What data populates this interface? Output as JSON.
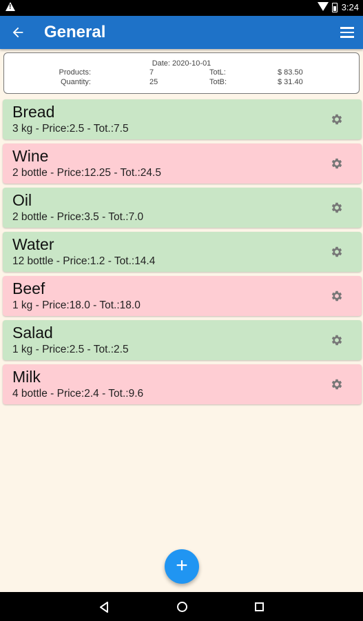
{
  "status_bar": {
    "time": "3:24",
    "icons": [
      "warning-icon",
      "wifi-icon",
      "battery-icon"
    ]
  },
  "app_bar": {
    "title": "General",
    "back_icon": "arrow-left-icon",
    "menu_icon": "hamburger-menu-icon",
    "color": "#1e72c8"
  },
  "summary": {
    "date": "Date: 2020-10-01",
    "products_label": "Products:",
    "products_value": "7",
    "quantity_label": "Quantity:",
    "quantity_value": "25",
    "totl_label": "TotL:",
    "totl_value": "$ 83.50",
    "totb_label": "TotB:",
    "totb_value": "$ 31.40"
  },
  "items": [
    {
      "name": "Bread",
      "detail": "3 kg - Price:2.5 - Tot.:7.5",
      "status": "green"
    },
    {
      "name": "Wine",
      "detail": "2 bottle - Price:12.25 - Tot.:24.5",
      "status": "red"
    },
    {
      "name": "Oil",
      "detail": "2 bottle - Price:3.5 - Tot.:7.0",
      "status": "green"
    },
    {
      "name": "Water",
      "detail": "12 bottle - Price:1.2 - Tot.:14.4",
      "status": "green"
    },
    {
      "name": "Beef",
      "detail": "1 kg - Price:18.0 - Tot.:18.0",
      "status": "red"
    },
    {
      "name": "Salad",
      "detail": "1 kg - Price:2.5 - Tot.:2.5",
      "status": "green"
    },
    {
      "name": "Milk",
      "detail": "4 bottle - Price:2.4 - Tot.:9.6",
      "status": "red"
    }
  ],
  "colors": {
    "green_item": "#c9e6c6",
    "red_item": "#fecdd3",
    "background": "#fdf5e8",
    "fab": "#2095f2"
  },
  "fab": {
    "label": "+",
    "icon": "plus-icon"
  },
  "nav_bar": {
    "icons": [
      "nav-back-icon",
      "nav-home-icon",
      "nav-recent-icon"
    ]
  }
}
